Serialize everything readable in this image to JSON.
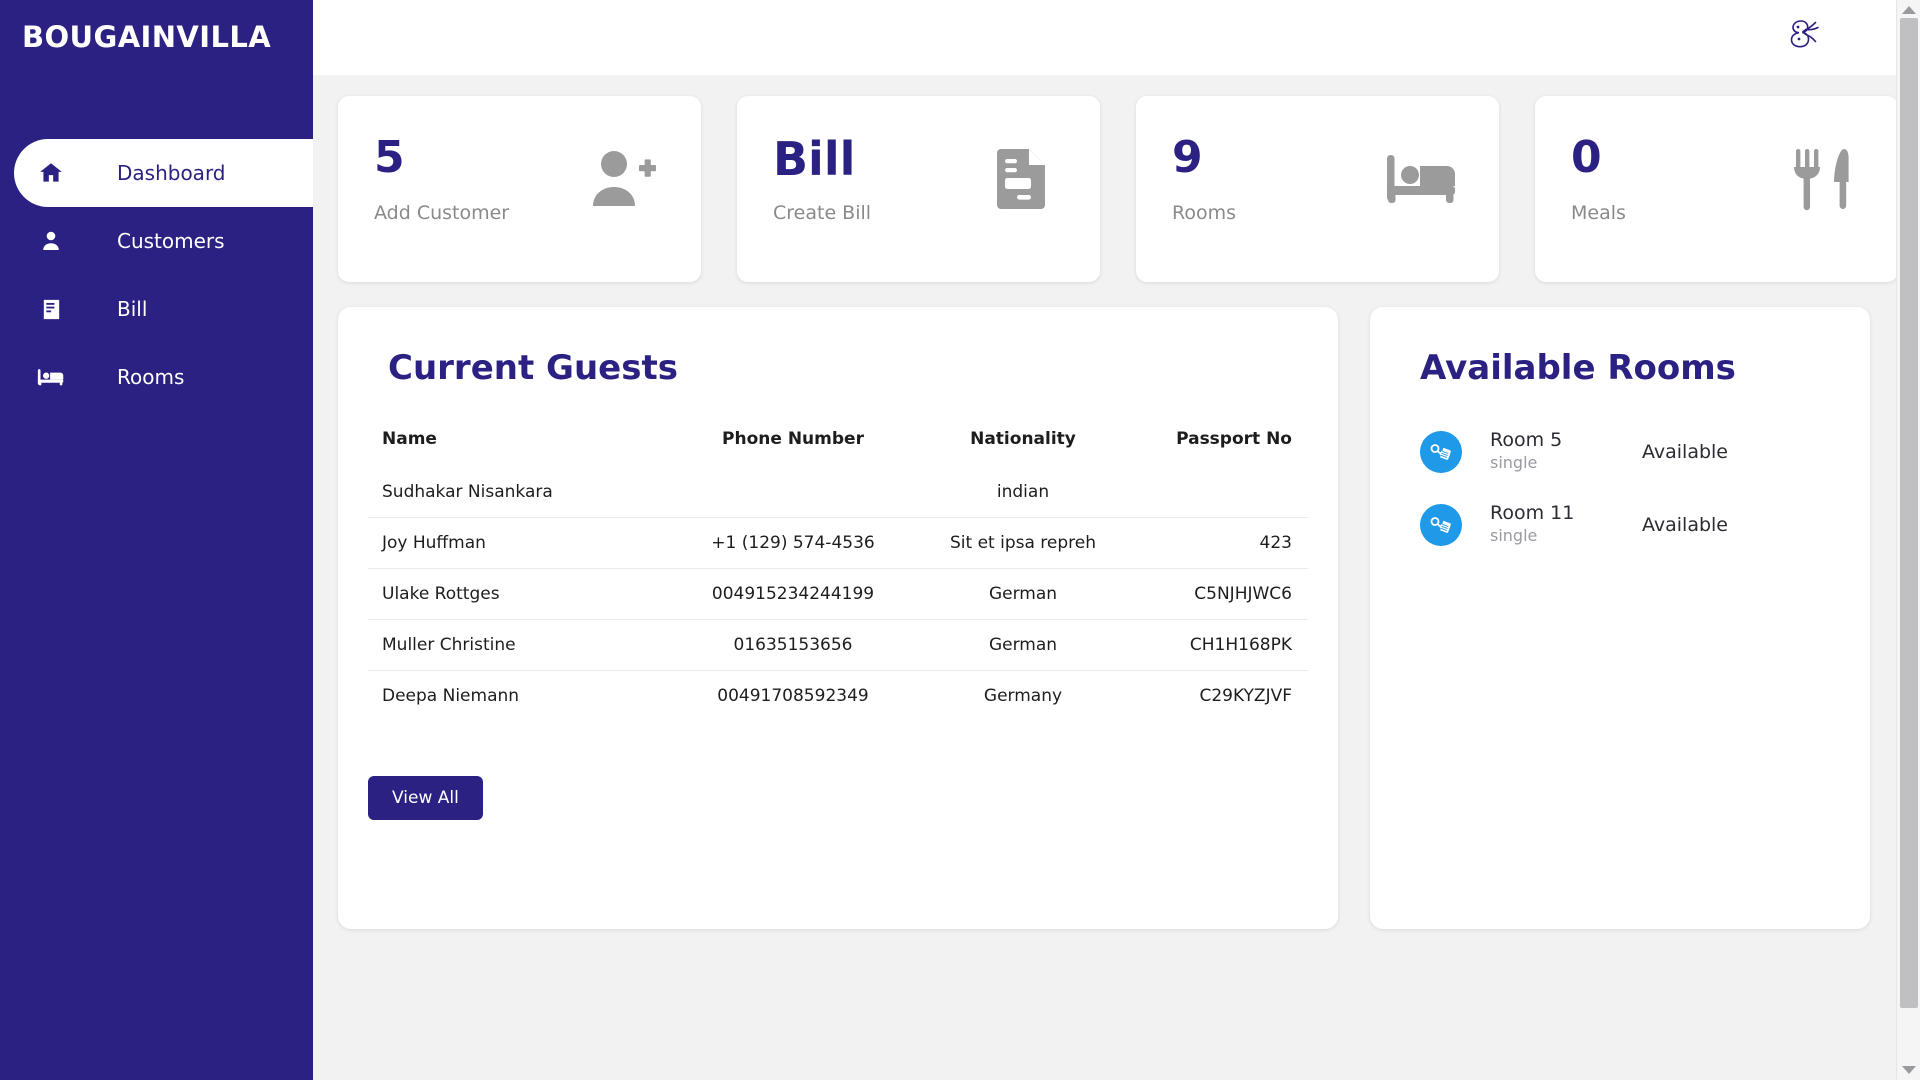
{
  "brand": {
    "name": "BOUGAINVILLA",
    "logo_icon": "script-monogram-logo"
  },
  "sidebar": {
    "items": [
      {
        "label": "Dashboard",
        "icon": "home-icon",
        "active": true
      },
      {
        "label": "Customers",
        "icon": "person-icon",
        "active": false
      },
      {
        "label": "Bill",
        "icon": "book-icon",
        "active": false
      },
      {
        "label": "Rooms",
        "icon": "bed-icon",
        "active": false
      }
    ]
  },
  "stats": [
    {
      "value": "5",
      "label": "Add Customer",
      "icon": "person-add-icon"
    },
    {
      "value": "Bill",
      "label": "Create Bill",
      "icon": "invoice-document-icon"
    },
    {
      "value": "9",
      "label": "Rooms",
      "icon": "bed-icon"
    },
    {
      "value": "0",
      "label": "Meals",
      "icon": "fork-knife-icon"
    }
  ],
  "guests_panel": {
    "title": "Current Guests",
    "columns": [
      "Name",
      "Phone Number",
      "Nationality",
      "Passport No"
    ],
    "rows": [
      {
        "name": "Sudhakar Nisankara",
        "phone": "",
        "nationality": "indian",
        "passport": ""
      },
      {
        "name": "Joy Huffman",
        "phone": "+1 (129) 574-4536",
        "nationality": "Sit et ipsa repreh",
        "passport": "423"
      },
      {
        "name": "Ulake Rottges",
        "phone": "004915234244199",
        "nationality": "German",
        "passport": "C5NJHJWC6"
      },
      {
        "name": "Muller Christine",
        "phone": "01635153656",
        "nationality": "German",
        "passport": "CH1H168PK"
      },
      {
        "name": "Deepa Niemann",
        "phone": "00491708592349",
        "nationality": "Germany",
        "passport": "C29KYZJVF"
      }
    ],
    "view_all_label": "View All"
  },
  "rooms_panel": {
    "title": "Available Rooms",
    "rooms": [
      {
        "name": "Room 5",
        "type": "single",
        "status": "Available",
        "icon": "room-key-icon"
      },
      {
        "name": "Room 11",
        "type": "single",
        "status": "Available",
        "icon": "room-key-icon"
      }
    ]
  },
  "colors": {
    "brand_indigo": "#2a2182",
    "room_icon_blue": "#1e9ae8",
    "page_background": "#f2f2f2",
    "stat_icon_gray": "#9b9b9b"
  }
}
